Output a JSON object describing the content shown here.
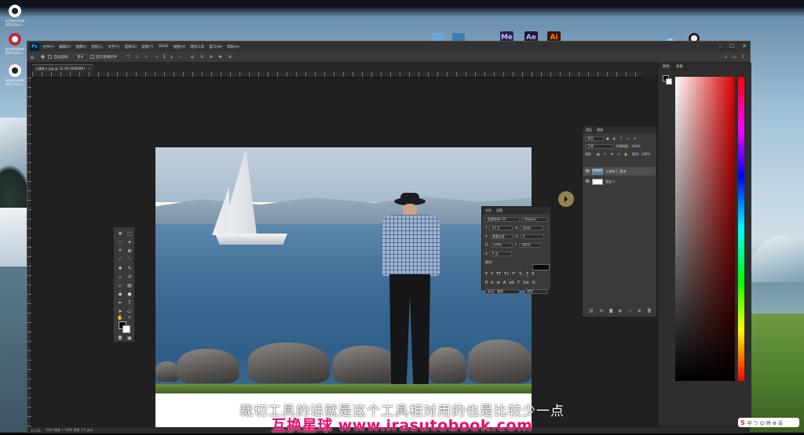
{
  "desktop": {
    "icons": [
      {
        "name": "app-shortcut-1",
        "label": "Screenshots 2023-10-1..."
      },
      {
        "name": "app-shortcut-2",
        "label": "Screenshots 2023-10-1..."
      },
      {
        "name": "app-shortcut-3",
        "label": "Screenshots 2023-10-1..."
      }
    ],
    "dock": {
      "me": "Me",
      "ae": "Ae",
      "ai": "Ai"
    }
  },
  "photoshop": {
    "logo": "Ps",
    "menu": [
      "文件(F)",
      "编辑(E)",
      "图像(I)",
      "图层(L)",
      "文字(Y)",
      "选择(S)",
      "滤镜(T)",
      "3D(D)",
      "视图(V)",
      "增效工具",
      "窗口(W)",
      "帮助(H)"
    ],
    "options": {
      "auto_select": "自动选择：",
      "layer_select": "图层",
      "transform": "显示变换控件"
    },
    "document_tab": "沙滩老人.jpg @ 33.3% (RGB/8#)",
    "status": [
      "33.3%",
      "1920 像素 x 1080 像素 (72 ppi)"
    ],
    "character_panel": {
      "tabs": [
        "字符",
        "段落"
      ],
      "font": "思源宋体 CN",
      "style": "Regular",
      "size": "12 点",
      "leading": "(自动)",
      "kerning": "度量标准",
      "tracking": "0",
      "scale_v": "100%",
      "scale_h": "100%",
      "baseline": "0 点",
      "color_label": "颜色:",
      "language": "英语：美国",
      "aa": "锐利"
    },
    "layers_panel": {
      "tabs": [
        "图层",
        "通道"
      ],
      "filter": "类型",
      "blend": "正常",
      "opacity": "不透明度：100%",
      "lock": "锁定：",
      "fill": "填充：100%",
      "layers": [
        {
          "name": "沙滩老人_看海",
          "selected": true
        },
        {
          "name": "图层 1",
          "selected": false
        }
      ]
    },
    "color_panel": {
      "tabs": [
        "颜色",
        "色板"
      ]
    }
  },
  "subtitle": "裁切工具的话就是这个工具相对用的也是比较少一点",
  "watermark": "互换星球 www.irasutobook.com",
  "sogou": "中 ㄅ ☺ 拼 ⚙ 设"
}
